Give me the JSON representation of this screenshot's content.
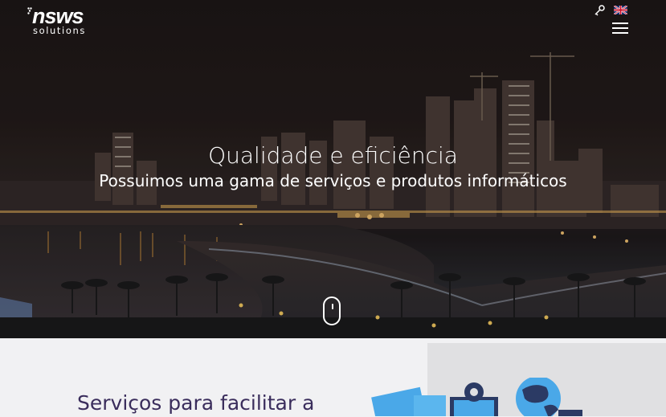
{
  "brand": {
    "logo_main": "nsws",
    "logo_sub": "solutions"
  },
  "header": {
    "icons": [
      "key-icon",
      "uk-flag-icon",
      "hamburger-menu-icon"
    ]
  },
  "hero": {
    "title": "Qualidade e eficiência",
    "subtitle": "Possuimos uma gama de serviços e produtos informáticos"
  },
  "section": {
    "heading": "Serviços para facilitar a"
  },
  "colors": {
    "accent_text": "#3a2d5c",
    "hero_bg": "#1d1717",
    "illustration_blue": "#4aa8e8"
  }
}
